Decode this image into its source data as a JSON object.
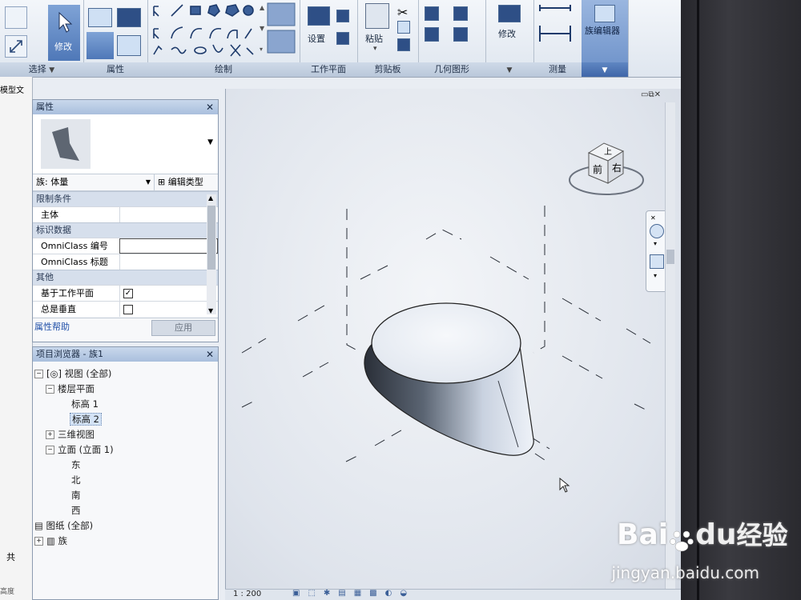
{
  "ribbon": {
    "select_btn": "修改",
    "groups": {
      "select": "选择",
      "properties": "属性",
      "draw": "绘制",
      "workplane": "工作平面",
      "clipboard": "剪贴板",
      "geometry": "几何图形",
      "modify_group": "",
      "measure": "测量",
      "family_editor": ""
    },
    "workplane_set": "设置",
    "clipboard_paste": "粘贴",
    "modify_label": "修改",
    "family_editor_label": "族编辑器"
  },
  "leftstrip": {
    "top_text": "模型文",
    "bottom_text": "共",
    "bottom_text2": "高度"
  },
  "properties_panel": {
    "title": "属性",
    "family_selector": "族: 体量",
    "edit_type": "编辑类型",
    "categories": [
      {
        "label": "限制条件",
        "rows": [
          {
            "key": "主体",
            "value": ""
          }
        ]
      },
      {
        "label": "标识数据",
        "rows": [
          {
            "key": "OmniClass 编号",
            "value": ""
          },
          {
            "key": "OmniClass 标题",
            "value": ""
          }
        ]
      },
      {
        "label": "其他",
        "rows": [
          {
            "key": "基于工作平面",
            "checked": true
          },
          {
            "key": "总是垂直",
            "checked": false
          }
        ]
      }
    ],
    "help_link": "属性帮助",
    "apply": "应用"
  },
  "project_browser": {
    "title": "项目浏览器 - 族1",
    "nodes": {
      "views": "视图 (全部)",
      "floor_plans": "楼层平面",
      "level1": "标高 1",
      "level2": "标高 2",
      "3d": "三维视图",
      "elevations": "立面 (立面 1)",
      "east": "东",
      "north": "北",
      "south": "南",
      "west": "西",
      "sheets": "图纸 (全部)",
      "families": "族"
    }
  },
  "viewcube": {
    "front": "前",
    "right": "右",
    "top": "上"
  },
  "statusbar": {
    "scale": "1 : 200"
  },
  "watermark": {
    "brand": "Bai",
    "brand2": "du",
    "service": "经验",
    "url": "jingyan.baidu.com"
  }
}
